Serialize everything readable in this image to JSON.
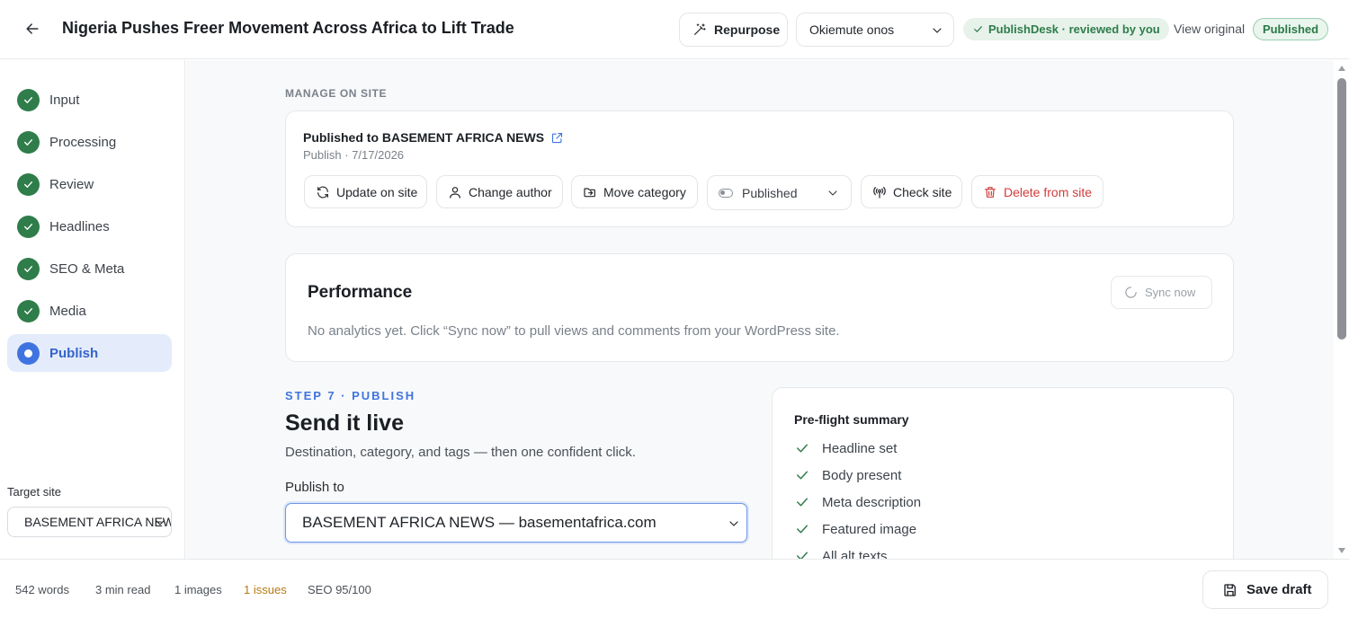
{
  "header": {
    "title": "Nigeria Pushes Freer Movement Across Africa to Lift Trade",
    "repurpose_label": "Repurpose",
    "author": "Okiemute onos",
    "reviewed_badge": "PublishDesk · reviewed by you",
    "view_original": "View original",
    "status_pill": "Published"
  },
  "sidebar": {
    "steps": [
      {
        "label": "Input",
        "state": "done"
      },
      {
        "label": "Processing",
        "state": "done"
      },
      {
        "label": "Review",
        "state": "done"
      },
      {
        "label": "Headlines",
        "state": "done"
      },
      {
        "label": "SEO & Meta",
        "state": "done"
      },
      {
        "label": "Media",
        "state": "done"
      },
      {
        "label": "Publish",
        "state": "active"
      }
    ],
    "target_label": "Target site",
    "target_value": "BASEMENT AFRICA NEWS"
  },
  "manage": {
    "section_label": "MANAGE ON SITE",
    "title": "Published to BASEMENT AFRICA NEWS",
    "subtitle": "Publish · 7/17/2026",
    "actions": {
      "update": "Update on site",
      "change_author": "Change author",
      "move_category": "Move category",
      "status": "Published",
      "check_site": "Check site",
      "delete": "Delete from site"
    }
  },
  "performance": {
    "title": "Performance",
    "sync_label": "Sync now",
    "empty_text": "No analytics yet. Click “Sync now” to pull views and comments from your WordPress site."
  },
  "publish": {
    "kicker": "STEP 7 · PUBLISH",
    "title": "Send it live",
    "subtitle": "Destination, category, and tags — then one confident click.",
    "publish_to_label": "Publish to",
    "publish_to_value": "BASEMENT AFRICA NEWS — basementafrica.com"
  },
  "preflight": {
    "title": "Pre-flight summary",
    "items": [
      "Headline set",
      "Body present",
      "Meta description",
      "Featured image",
      "All alt texts"
    ]
  },
  "footer": {
    "words": "542 words",
    "read_time": "3 min read",
    "images": "1 images",
    "issues": "1 issues",
    "seo": "SEO 95/100",
    "save_label": "Save draft"
  },
  "colors": {
    "accent": "#3f74e0",
    "success": "#2f7d4a",
    "danger": "#d23b3b",
    "warning": "#b57a12"
  }
}
